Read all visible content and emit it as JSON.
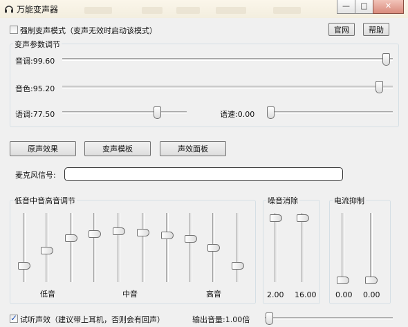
{
  "window": {
    "title": "万能变声器",
    "buttons": {
      "minimize": "—",
      "maximize": "□",
      "close": "✕"
    }
  },
  "header": {
    "force_mode_label": "强制变声模式（变声无效时启动该模式）",
    "force_mode_checked": false,
    "official_site_button": "官网",
    "help_button": "帮助"
  },
  "params_group": {
    "legend": "变声参数调节",
    "pitch": {
      "label": "音调:99.60",
      "value": 99.6
    },
    "timbre": {
      "label": "音色:95.20",
      "value": 95.2
    },
    "intonation": {
      "label": "语调:77.50",
      "value": 77.5
    },
    "speed": {
      "label": "语速:0.00",
      "value": 0.0
    }
  },
  "mode_buttons": {
    "original": "原声效果",
    "template": "变声模板",
    "effects": "声效面板"
  },
  "mic": {
    "label": "麦克风信号:",
    "level": 0
  },
  "eq_group": {
    "legend": "低音中音高音调节",
    "low_label": "低音",
    "mid_label": "中音",
    "high_label": "高音",
    "band_levels": [
      0.2,
      0.45,
      0.65,
      0.72,
      0.76,
      0.74,
      0.7,
      0.64,
      0.5,
      0.2
    ]
  },
  "noise_group": {
    "legend": "噪音消除",
    "slider1_value": "2.00",
    "slider2_value": "16.00"
  },
  "current_group": {
    "legend": "电流抑制",
    "slider1_value": "0.00",
    "slider2_value": "0.00"
  },
  "footer": {
    "monitor_label": "试听声效（建议带上耳机，否则会有回声）",
    "monitor_checked": true,
    "output_volume_label": "输出音量:1.00倍"
  }
}
